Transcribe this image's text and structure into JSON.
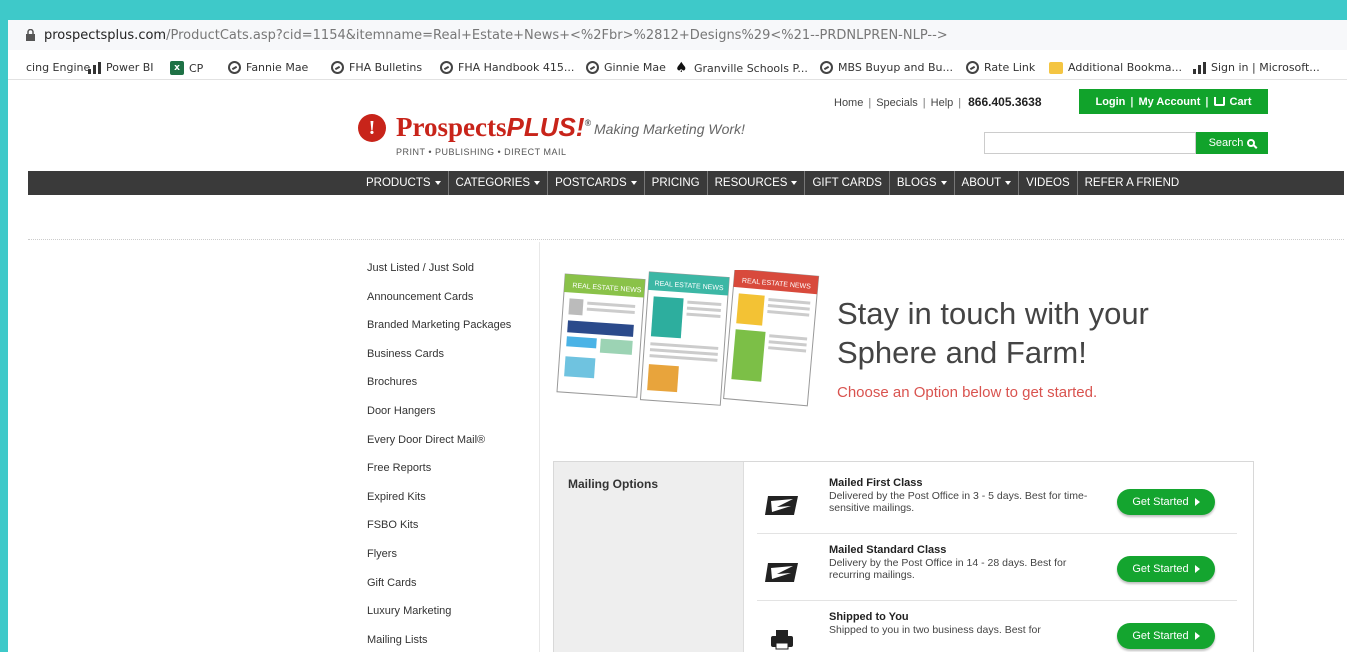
{
  "browser": {
    "url_host": "prospectsplus.com",
    "url_path": "/ProductCats.asp?cid=1154&itemname=Real+Estate+News+<%2Fbr>%2812+Designs%29<%21--PRDNLPREN-NLP-->",
    "bookmarks": [
      {
        "label": "cing Engine",
        "icon": "none"
      },
      {
        "label": "Power BI",
        "icon": "bars-icon"
      },
      {
        "label": "CP",
        "icon": "excel-icon"
      },
      {
        "label": "Fannie Mae",
        "icon": "globe-icon"
      },
      {
        "label": "FHA Bulletins",
        "icon": "globe-icon"
      },
      {
        "label": "FHA Handbook 415...",
        "icon": "globe-icon"
      },
      {
        "label": "Ginnie Mae",
        "icon": "globe-icon"
      },
      {
        "label": "Granville Schools P...",
        "icon": "spade-icon"
      },
      {
        "label": "MBS Buyup and Bu...",
        "icon": "globe-icon"
      },
      {
        "label": "Rate Link",
        "icon": "globe-icon"
      },
      {
        "label": "Additional Bookma...",
        "icon": "folder-icon"
      },
      {
        "label": "Sign in | Microsoft...",
        "icon": "bars-icon"
      }
    ]
  },
  "header": {
    "links": [
      "Home",
      "Specials",
      "Help"
    ],
    "phone": "866.405.3638",
    "login": "Login",
    "account": "My Account",
    "cart": "Cart",
    "logo_mark": "!",
    "logo_prospects": "Prospects",
    "logo_plus": "PLUS!",
    "logo_reg": "®",
    "tagline": "Making Marketing Work!",
    "logo_sub": "PRINT • PUBLISHING • DIRECT MAIL",
    "search_button": "Search"
  },
  "nav": [
    {
      "label": "PRODUCTS",
      "caret": true
    },
    {
      "label": "CATEGORIES",
      "caret": true
    },
    {
      "label": "POSTCARDS",
      "caret": true
    },
    {
      "label": "PRICING",
      "caret": false
    },
    {
      "label": "RESOURCES",
      "caret": true
    },
    {
      "label": "GIFT CARDS",
      "caret": false
    },
    {
      "label": "BLOGS",
      "caret": true
    },
    {
      "label": "ABOUT",
      "caret": true
    },
    {
      "label": "VIDEOS",
      "caret": false
    },
    {
      "label": "REFER A FRIEND",
      "caret": false
    }
  ],
  "sidebar": [
    "Just Listed / Just Sold",
    "Announcement Cards",
    "Branded Marketing Packages",
    "Business Cards",
    "Brochures",
    "Door Hangers",
    "Every Door Direct Mail®",
    "Free Reports",
    "Expired Kits",
    "FSBO Kits",
    "Flyers",
    "Gift Cards",
    "Luxury Marketing",
    "Mailing Lists"
  ],
  "hero": {
    "title": "Stay in touch with your Sphere and Farm!",
    "subtitle": "Choose an Option below to get started.",
    "newsletter_masthead": "REAL ESTATE NEWS"
  },
  "mailing": {
    "heading": "Mailing Options",
    "options": [
      {
        "title": "Mailed First Class",
        "desc": "Delivered by the Post Office in 3 - 5 days. Best for time-sensitive mailings.",
        "button": "Get Started",
        "icon": "usps-eagle-icon"
      },
      {
        "title": "Mailed Standard Class",
        "desc": "Delivery by the Post Office in 14 - 28 days. Best for recurring mailings.",
        "button": "Get Started",
        "icon": "usps-eagle-icon"
      },
      {
        "title": "Shipped to You",
        "desc": "Shipped to you in two business days. Best for",
        "button": "Get Started",
        "icon": "printer-icon"
      }
    ]
  },
  "colors": {
    "frame": "#3ec9c9",
    "brand_red": "#c8241a",
    "green": "#11a32b",
    "nav": "#3a3a3a",
    "accent_red": "#d9534f"
  }
}
